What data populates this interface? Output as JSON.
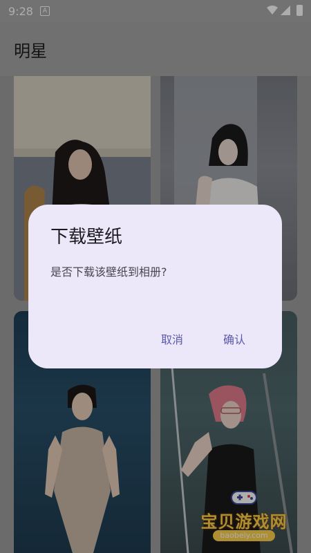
{
  "status_bar": {
    "time": "9:28",
    "notification_icon": "A",
    "icons": [
      "wifi-icon",
      "signal-icon",
      "battery-charging-icon"
    ]
  },
  "app_bar": {
    "title": "明星"
  },
  "wallpapers": [
    {
      "id": "wallpaper-1"
    },
    {
      "id": "wallpaper-2"
    },
    {
      "id": "wallpaper-3"
    },
    {
      "id": "wallpaper-4"
    }
  ],
  "watermark": {
    "text": "宝贝游戏网",
    "url": "baobeiy.com"
  },
  "dialog": {
    "title": "下载壁纸",
    "message": "是否下载该壁纸到相册?",
    "cancel_label": "取消",
    "confirm_label": "确认"
  },
  "colors": {
    "dialog_bg": "#ece8fa",
    "accent": "#5a59a8",
    "scrim": "rgba(0,0,0,0.32)"
  }
}
